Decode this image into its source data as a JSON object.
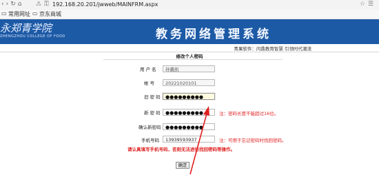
{
  "browser": {
    "url": "192.168.20.201/jwweb/MAINFRM.aspx",
    "bookmarks": [
      "常用网址",
      "京东商城"
    ]
  },
  "banner": {
    "school_name": "永郑青学院",
    "school_name_en": "ZHENGZHOU COLLEGE OF FOOD",
    "system_title": "教务网络管理系统"
  },
  "sub_header": "青果软件：问鼎教育智慧 引领时代潮流",
  "page_title": "修改个人密码",
  "form": {
    "username_label": "用 户 名",
    "username_value": "孙晨凯",
    "account_label": "帐 号",
    "account_value": "20221020101",
    "old_pwd_label": "旧 密 码",
    "old_pwd_value": "●●●●●●●●●",
    "new_pwd_label": "新 密 码",
    "new_pwd_value": "●●●●●●●●●",
    "new_pwd_hint": "注：密码长度不能超过16位。",
    "confirm_label": "确认新密码",
    "confirm_value": "●●●●●●●●●",
    "phone_label": "手机号码",
    "phone_value": "13939593937",
    "phone_hint": "注：可用于忘记密码时找回密码。",
    "warning": "请认真填写手机号码，否则无法进行找回密码等操作。",
    "submit_label": "确定"
  },
  "colors": {
    "banner_bg": "#1d5aa6",
    "hint_red": "#e02020",
    "annotation_arrow": "#e02020"
  }
}
